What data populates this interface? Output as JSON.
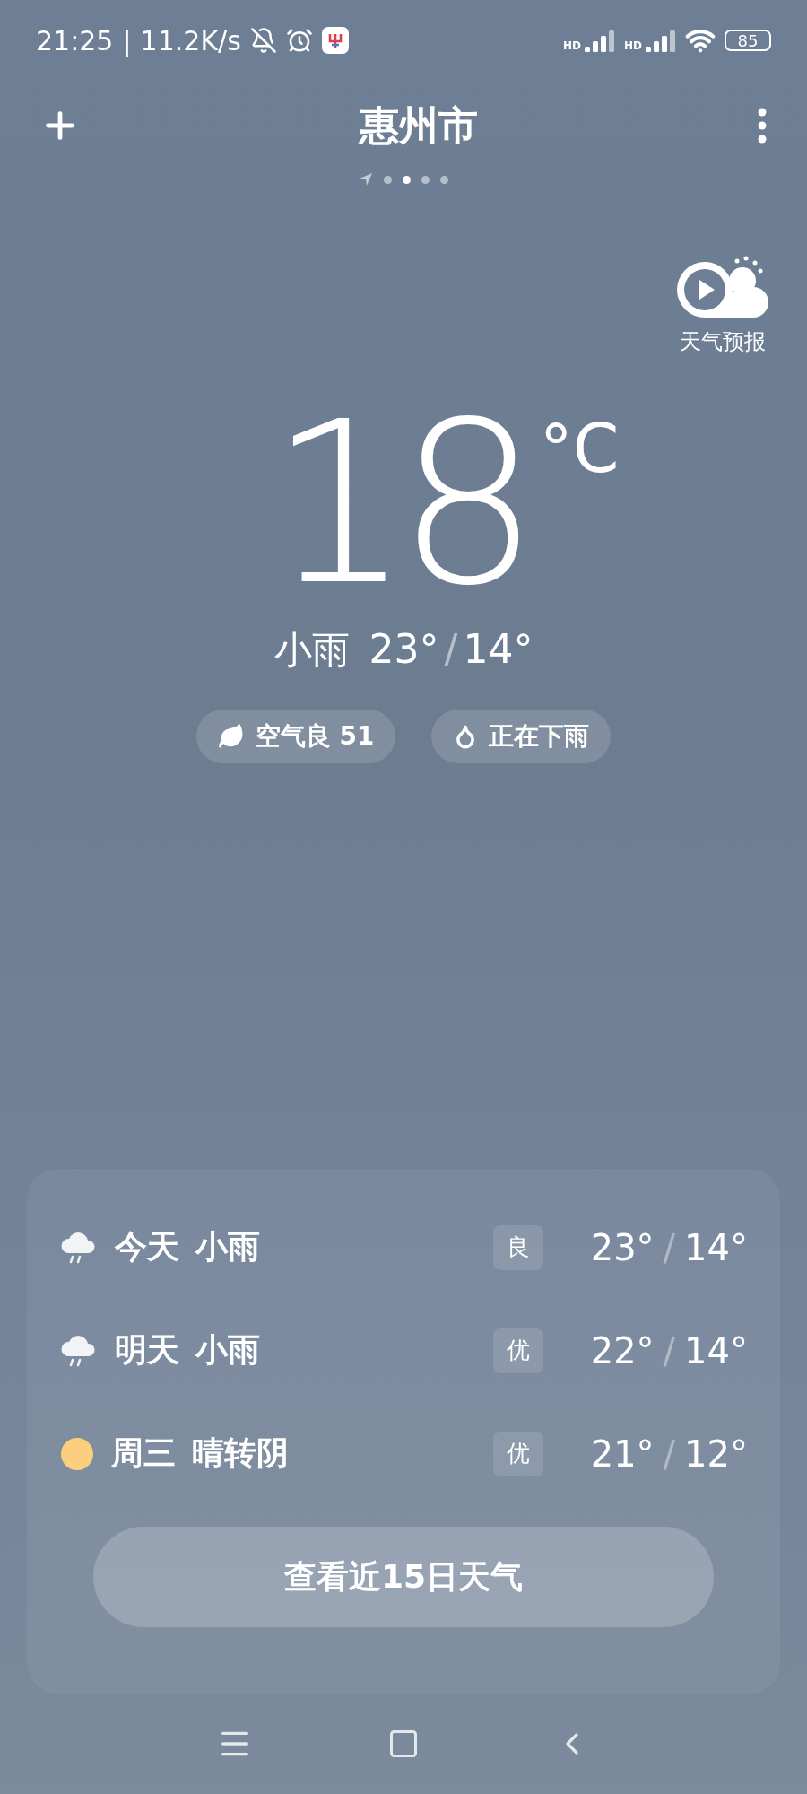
{
  "status_bar": {
    "time": "21:25",
    "divider": "|",
    "net_speed": "11.2K/s",
    "sim_labels": [
      "HD",
      "HD"
    ],
    "battery": "85"
  },
  "header": {
    "city": "惠州市",
    "page_dots": [
      {
        "kind": "location",
        "selected": false
      },
      {
        "kind": "dot",
        "selected": false
      },
      {
        "kind": "dot",
        "selected": true
      },
      {
        "kind": "dot",
        "selected": false
      },
      {
        "kind": "dot",
        "selected": false
      }
    ]
  },
  "video_forecast": {
    "label": "天气预报"
  },
  "current": {
    "temperature": "18",
    "unit": "°C",
    "condition": "小雨",
    "high": "23°",
    "separator": "/",
    "low": "14°"
  },
  "chips": [
    {
      "kind": "air",
      "label": "空气良 51"
    },
    {
      "kind": "rain",
      "label": "正在下雨"
    }
  ],
  "forecast": [
    {
      "kind": "rain",
      "day": "今天",
      "condition": "小雨",
      "aqi": "良",
      "high": "23°",
      "separator": "/",
      "low": "14°"
    },
    {
      "kind": "rain",
      "day": "明天",
      "condition": "小雨",
      "aqi": "优",
      "high": "22°",
      "separator": "/",
      "low": "14°"
    },
    {
      "kind": "sun",
      "day": "周三",
      "condition": "晴转阴",
      "aqi": "优",
      "high": "21°",
      "separator": "/",
      "low": "12°"
    }
  ],
  "forecast_button": "查看近15日天气"
}
